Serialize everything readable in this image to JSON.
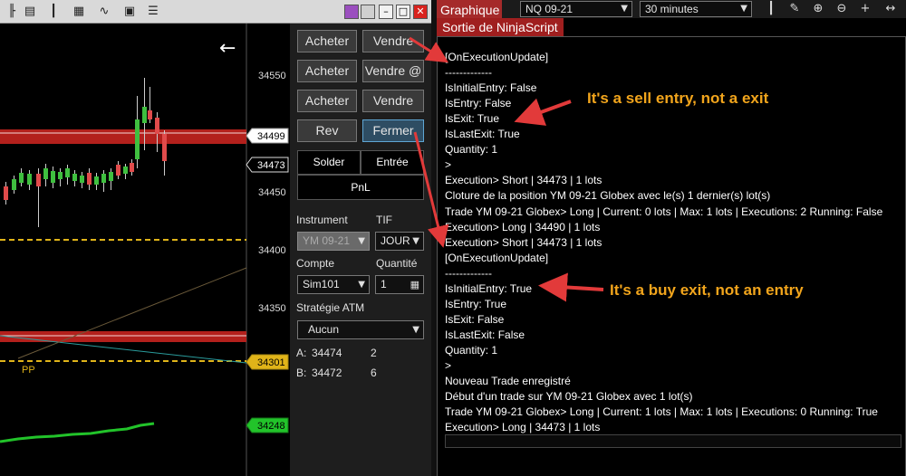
{
  "chart": {
    "price_ticks": [
      "34550",
      "34450",
      "34400",
      "34350"
    ],
    "marker_labels": {
      "red_high": "34499",
      "last": "34473",
      "yellow": "34301",
      "green": "34248"
    },
    "pp_label": "PP",
    "colors": {
      "up_candle": "#3fbf3f",
      "down_candle": "#e04b4b",
      "red_zone": "#b3201c",
      "dash_line": "#e0b419",
      "green_line": "#22c32a"
    }
  },
  "toolbar_icons": [
    "cursor-icon",
    "properties-icon",
    "bar-chart-icon",
    "grid-icon",
    "line-chart-icon",
    "alert-icon",
    "list-icon"
  ],
  "order_panel": {
    "buy_labels": [
      "Acheter",
      "Acheter",
      "Acheter"
    ],
    "sell_labels": [
      "Vendre",
      "Vendre @",
      "Vendre"
    ],
    "rev_label": "Rev",
    "close_label": "Fermer",
    "solder_label": "Solder",
    "entry_label": "Entrée",
    "pnl_label": "PnL",
    "instrument_label": "Instrument",
    "tif_label": "TIF",
    "instrument_value": "YM 09-21",
    "tif_value": "JOUR",
    "account_label": "Compte",
    "quantity_label": "Quantité",
    "account_value": "Sim101",
    "quantity_value": "1",
    "atm_label": "Stratégie ATM",
    "atm_value": "Aucun",
    "ask_label": "A:",
    "ask_price": "34474",
    "ask_size": "2",
    "bid_label": "B:",
    "bid_price": "34472",
    "bid_size": "6"
  },
  "output_panel": {
    "graph_tab": "Graphique",
    "instrument_select": "NQ 09-21",
    "interval_select": "30 minutes",
    "title": "Sortie de NinjaScript",
    "lines": [
      "[OnExecutionUpdate]",
      "-------------",
      "IsInitialEntry: False",
      "IsEntry: False",
      "IsExit: True",
      "IsLastExit: True",
      "Quantity: 1",
      ">",
      "Execution> Short | 34473 | 1 lots",
      "Cloture de la position YM 09-21 Globex avec le(s) 1 dernier(s) lot(s)",
      "Trade YM 09-21 Globex> Long | Current: 0 lots | Max: 1 lots | Executions: 2 Running: False",
      "Execution> Long | 34490 | 1 lots",
      "Execution> Short | 34473 | 1 lots",
      "[OnExecutionUpdate]",
      "-------------",
      "IsInitialEntry: True",
      "IsEntry: True",
      "IsExit: False",
      "IsLastExit: False",
      "Quantity: 1",
      ">",
      "Nouveau Trade enregistré",
      "Début d'un trade sur YM 09-21 Globex avec 1 lot(s)",
      "Trade YM 09-21 Globex> Long | Current: 1 lots | Max: 1 lots | Executions: 0 Running: True",
      "Execution> Long | 34473 | 1 lots"
    ]
  },
  "annotations": {
    "first": "It's a sell entry, not a exit",
    "second": "It's a buy exit, not an entry",
    "color": "#f2a51c"
  }
}
